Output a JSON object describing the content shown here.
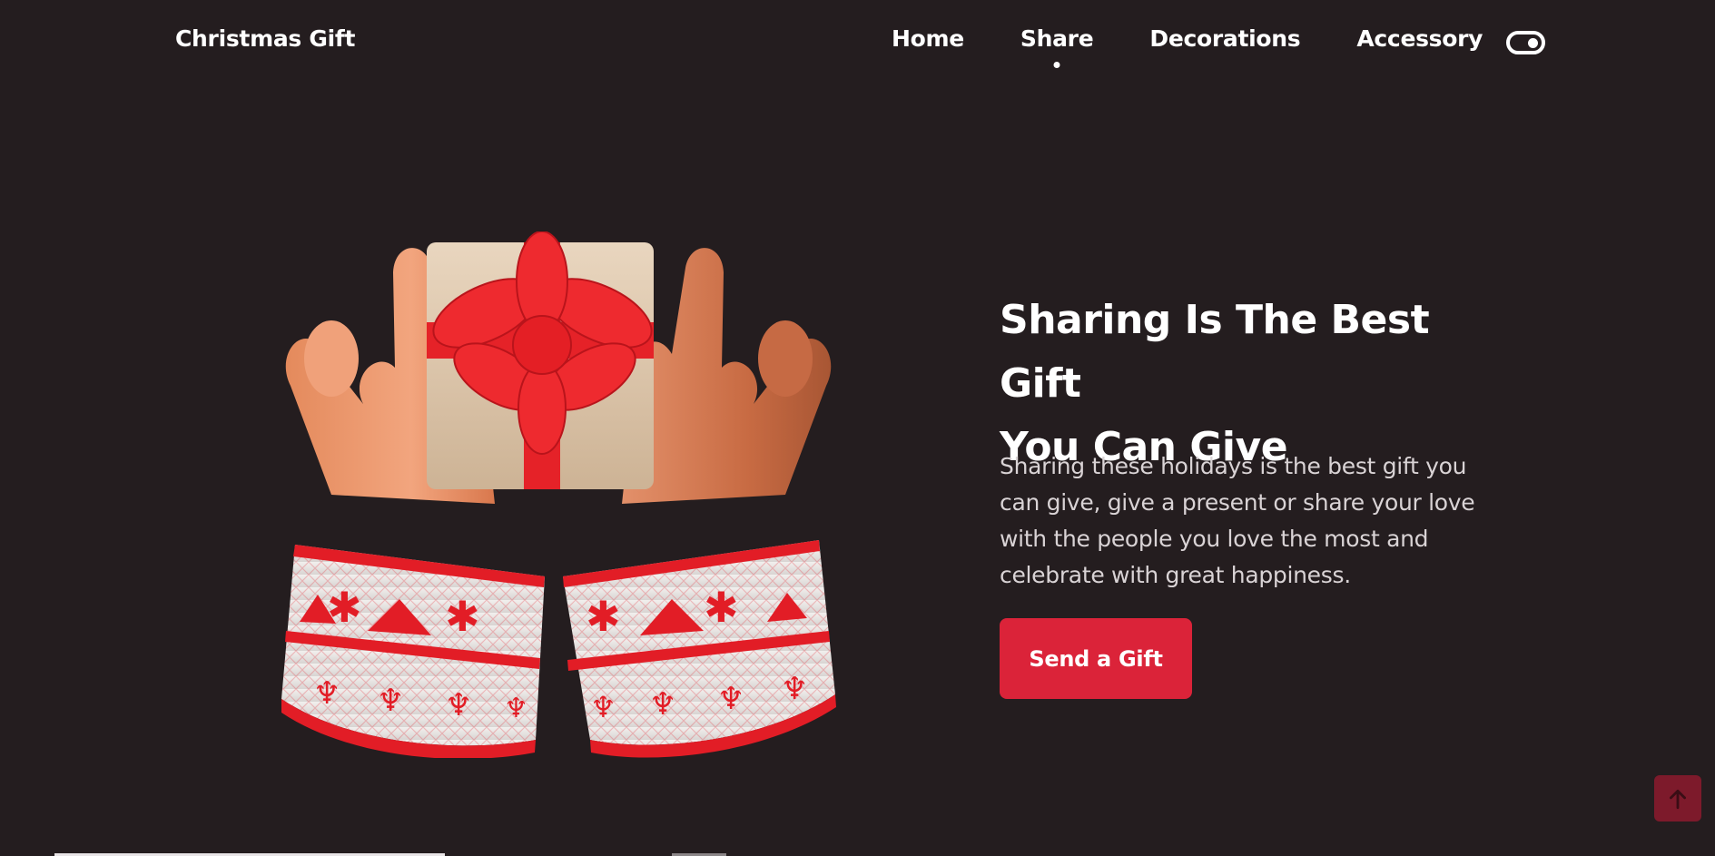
{
  "header": {
    "logo": "Christmas Gift",
    "nav": [
      {
        "label": "Home",
        "active": false
      },
      {
        "label": "Share",
        "active": true
      },
      {
        "label": "Decorations",
        "active": false
      },
      {
        "label": "Accessory",
        "active": false
      }
    ],
    "theme_toggle_icon": "toggle-switch-icon"
  },
  "hero": {
    "illustration_icon": "hands-holding-gift-illustration",
    "title_line1": "Sharing Is The Best Gift",
    "title_line2": "You Can Give",
    "description": "Sharing these holidays is the best gift you can give, give a present or share your love with the people you love the most and celebrate with great happiness.",
    "cta_label": "Send a Gift"
  },
  "scroll_up_icon": "arrow-up-icon",
  "colors": {
    "background": "#241d1f",
    "accent": "#db2339",
    "scroll_button": "#7d1a2b",
    "text": "#ffffff",
    "muted_text": "#d9d3d5"
  }
}
